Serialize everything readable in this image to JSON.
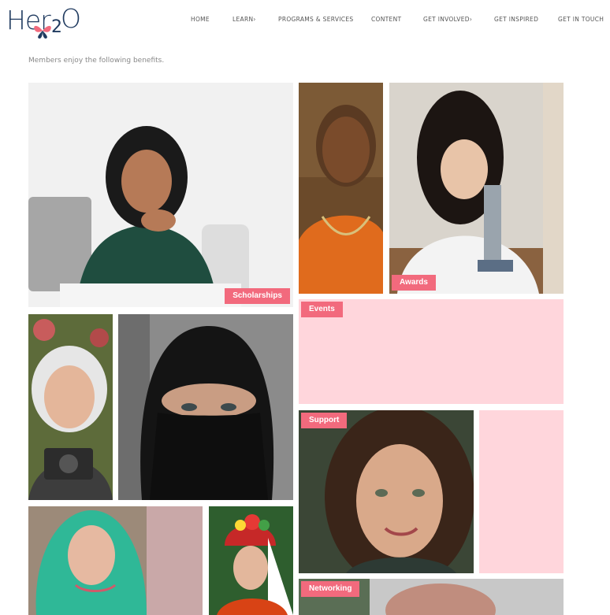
{
  "brand": {
    "logo_text_part1": "Her",
    "logo_text_part2": "2",
    "logo_text_part3": "O",
    "accent_color": "#f26a7d",
    "text_color": "#1f3a5f",
    "tile_pink": "#ffd6dc"
  },
  "nav": {
    "items": [
      {
        "label": "HOME"
      },
      {
        "label": "LEARN›"
      },
      {
        "label": "PROGRAMS & SERVICES"
      },
      {
        "label": "CONTENT"
      },
      {
        "label": "GET INVOLVED›"
      },
      {
        "label": "GET INSPIRED"
      },
      {
        "label": "GET IN TOUCH"
      }
    ]
  },
  "intro_text": "Members enjoy the following benefits.",
  "tiles": {
    "scholarships": {
      "label": "Scholarships"
    },
    "awards": {
      "label": "Awards"
    },
    "events": {
      "label": "Events"
    },
    "support": {
      "label": "Support"
    },
    "networking": {
      "label": "Networking"
    }
  }
}
